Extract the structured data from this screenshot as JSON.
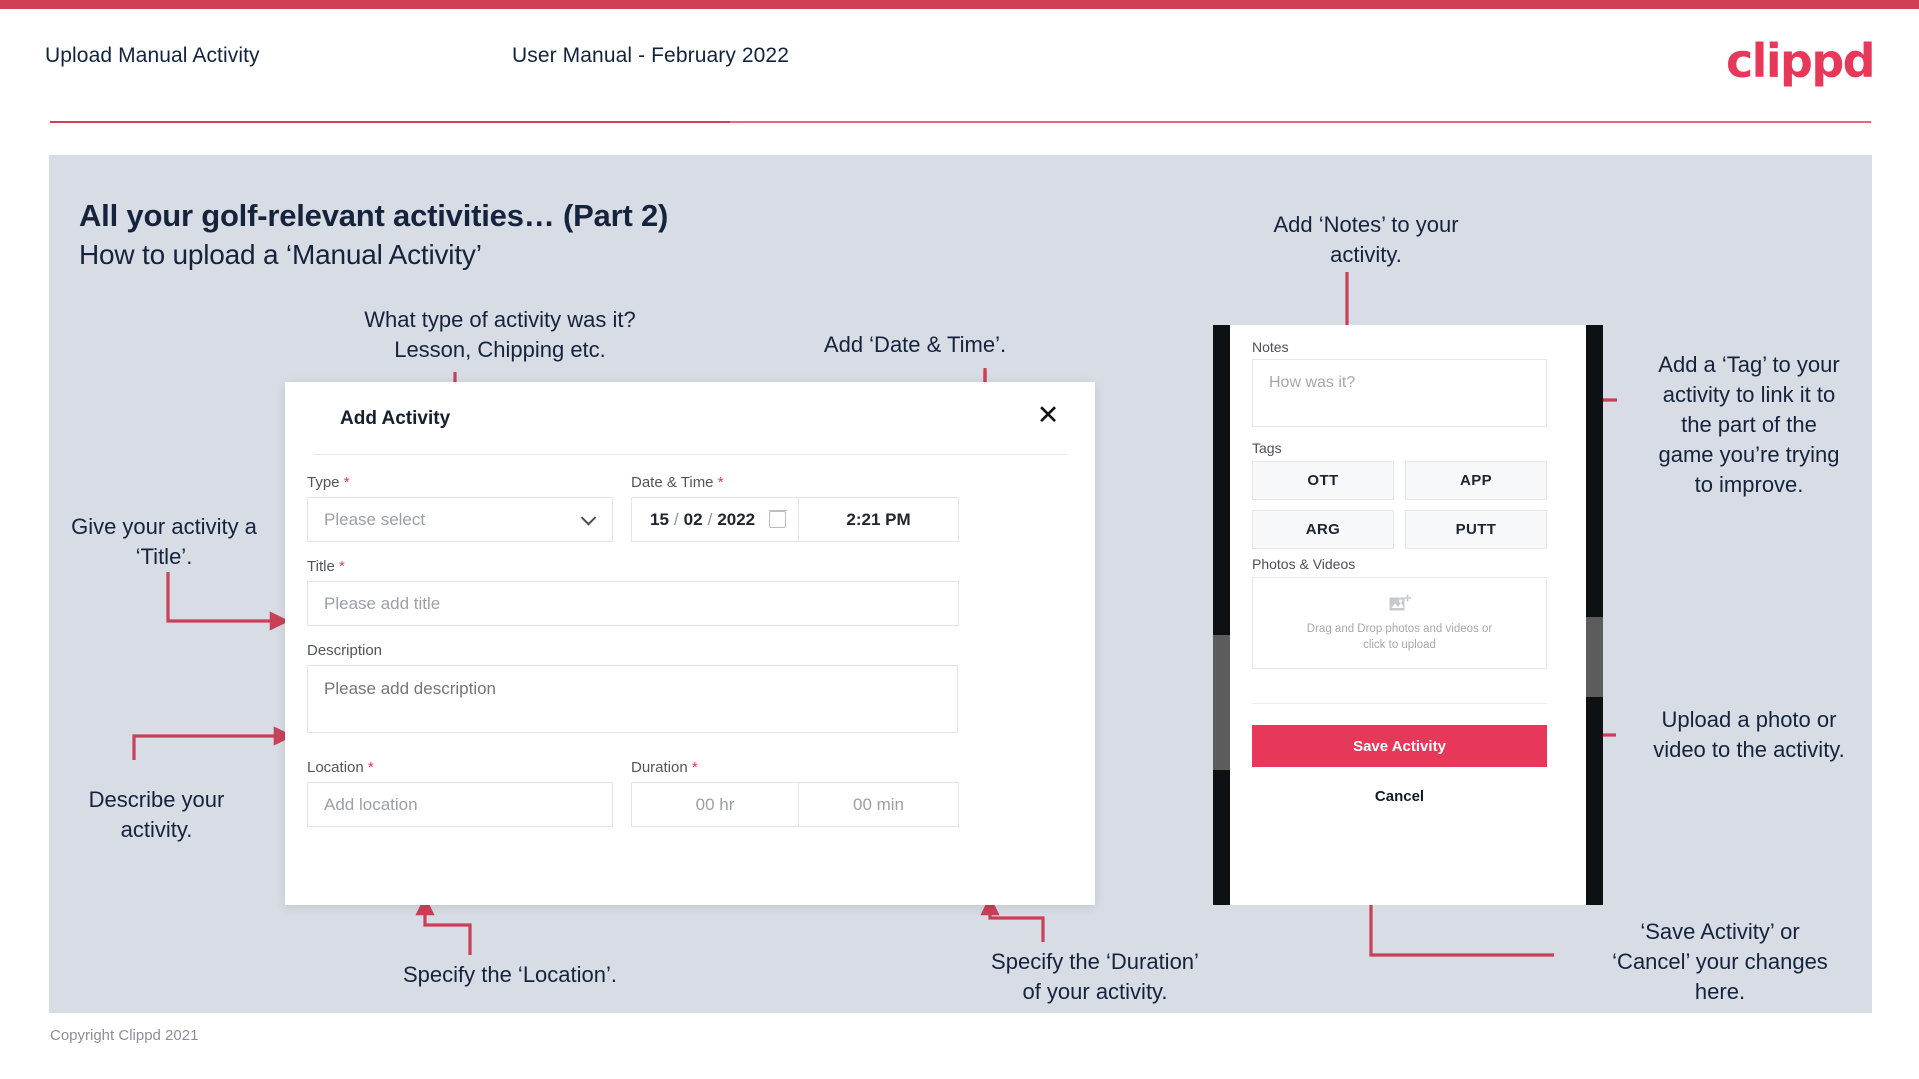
{
  "header": {
    "title": "Upload Manual Activity",
    "subtitle": "User Manual - February 2022",
    "logo": "clippd"
  },
  "slide": {
    "title": "All your golf-relevant activities… (Part 2)",
    "subtitle": "How to upload a ‘Manual Activity’"
  },
  "footer": {
    "copyright": "Copyright Clippd 2021"
  },
  "colors": {
    "accent": "#e8385a",
    "top_bar": "#cf4057",
    "slide_bg": "#d7dce5",
    "text_dark": "#16233d",
    "arrow": "#c94159"
  },
  "dialog": {
    "title": "Add Activity",
    "close_icon": "close-icon",
    "fields": {
      "type": {
        "label": "Type",
        "required": true,
        "placeholder": "Please select"
      },
      "datetime": {
        "label": "Date & Time",
        "required": true,
        "day": "15",
        "month": "02",
        "year": "2022",
        "separator": "/",
        "time": "2:21 PM",
        "calendar_icon": "calendar-icon"
      },
      "title": {
        "label": "Title",
        "required": true,
        "placeholder": "Please add title"
      },
      "description": {
        "label": "Description",
        "required": false,
        "placeholder": "Please add description"
      },
      "location": {
        "label": "Location",
        "required": true,
        "placeholder": "Add location"
      },
      "duration": {
        "label": "Duration",
        "required": true,
        "hours": "00 hr",
        "minutes": "00 min"
      }
    }
  },
  "phone": {
    "notes": {
      "label": "Notes",
      "placeholder": "How was it?"
    },
    "tags": {
      "label": "Tags",
      "items": [
        "OTT",
        "APP",
        "ARG",
        "PUTT"
      ]
    },
    "photos": {
      "label": "Photos & Videos",
      "icon": "add-image-icon",
      "drop_line1": "Drag and Drop photos and videos or",
      "drop_line2": "click to upload"
    },
    "save_label": "Save Activity",
    "cancel_label": "Cancel"
  },
  "annotations": {
    "type": "What type of activity was it?\nLesson, Chipping etc.",
    "datetime": "Add ‘Date & Time’.",
    "title": "Give your activity a\n‘Title’.",
    "description": "Describe your\nactivity.",
    "location": "Specify the ‘Location’.",
    "duration": "Specify the ‘Duration’\nof your activity.",
    "notes": "Add ‘Notes’ to your\nactivity.",
    "tags": "Add a ‘Tag’ to your\nactivity to link it to\nthe part of the\ngame you’re trying\nto improve.",
    "photos": "Upload a photo or\nvideo to the activity.",
    "save": "‘Save Activity’ or\n‘Cancel’ your changes\nhere."
  }
}
